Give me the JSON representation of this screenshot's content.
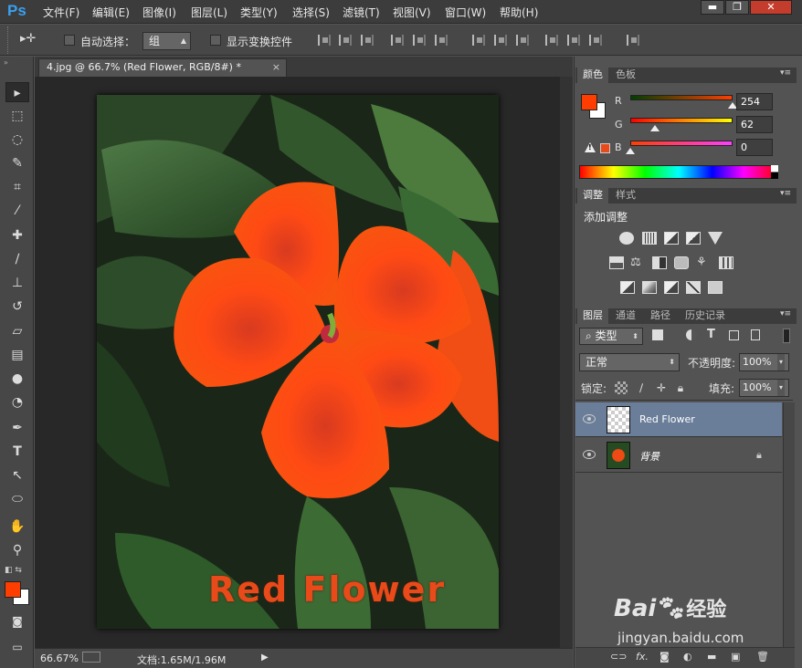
{
  "app": {
    "logo": "Ps"
  },
  "menu": [
    "文件(F)",
    "编辑(E)",
    "图像(I)",
    "图层(L)",
    "类型(Y)",
    "选择(S)",
    "滤镜(T)",
    "视图(V)",
    "窗口(W)",
    "帮助(H)"
  ],
  "window_buttons": {
    "minimize": "▬",
    "restore": "❐",
    "close": "✕"
  },
  "options": {
    "auto_select_label": "自动选择：",
    "auto_select_value": "组",
    "show_transform_label": "显示变换控件"
  },
  "document": {
    "tab_title": "4.jpg @ 66.7% (Red Flower, RGB/8#) *",
    "close": "×",
    "text_layer": "Red Flower"
  },
  "status": {
    "zoom": "66.67%",
    "doc_info": "文档:1.65M/1.96M",
    "arrow": "▶"
  },
  "color_panel": {
    "tabs": [
      "颜色",
      "色板"
    ],
    "r_label": "R",
    "g_label": "G",
    "b_label": "B",
    "r": "254",
    "g": "62",
    "b": "0",
    "r_frac": 0.996,
    "g_frac": 0.243,
    "b_frac": 0.0,
    "fg_color": "#fe3e00",
    "bg_color": "#ffffff",
    "warning": "!"
  },
  "adjust_panel": {
    "tabs": [
      "调整",
      "样式"
    ],
    "title": "添加调整"
  },
  "layers_panel": {
    "tabs": [
      "图层",
      "通道",
      "路径",
      "历史记录"
    ],
    "kind_filter": "类型",
    "blend_mode": "正常",
    "opacity_label": "不透明度:",
    "opacity": "100%",
    "lock_label": "锁定:",
    "fill_label": "填充:",
    "fill": "100%",
    "layers": [
      {
        "name": "Red Flower",
        "selected": true
      },
      {
        "name": "背景",
        "locked": true
      }
    ]
  },
  "watermark": {
    "brand": "Bai",
    "brand2": "经验",
    "url": "jingyan.baidu.com"
  }
}
